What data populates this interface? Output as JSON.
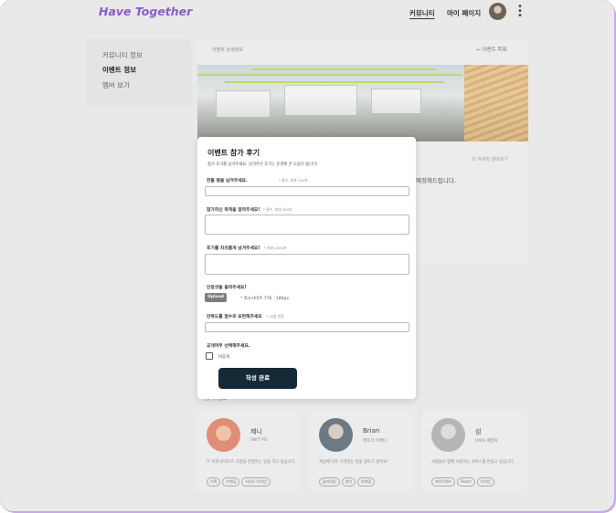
{
  "header": {
    "logo": "Have Together",
    "nav": [
      "커뮤니티",
      "마이 페이지"
    ],
    "menu_icon": "kebab-menu-icon",
    "avatar_icon": "user-avatar"
  },
  "sidebar": {
    "items": [
      {
        "label": "커뮤니티 정보"
      },
      {
        "label": "이벤트 정보"
      },
      {
        "label": "멤버 보기"
      }
    ]
  },
  "main": {
    "breadcrumb": "이벤트 상세정보",
    "back_link": "← 이벤트 목록",
    "more_link": "더 자세히 알아보기",
    "description_tail": "예정해드립니다.",
    "members_title": "멤버 정보"
  },
  "members": [
    {
      "name": "제니",
      "role": "UNIT PO",
      "desc": "IT 커뮤니티와 IT 기업을 연결하는 일을 하고 있습니다.",
      "tags": [
        "기획",
        "브랜딩",
        "서비스 디자인"
      ],
      "photo_color": "#e08e78"
    },
    {
      "name": "Brian",
      "role": "맨토크 이케다",
      "desc": "세상에 더욱 가치있는 일을 찾아고 싶어요!",
      "tags": [
        "플러터팀",
        "영어",
        "마케팅"
      ],
      "photo_color": "#6c7a86"
    },
    {
      "name": "섬",
      "role": "UXIS 개발자",
      "desc": "사람들이 함께 사용하는 서비스를 만들고 있습니다.",
      "tags": [
        "프론트엔드",
        "React",
        "디자인"
      ],
      "photo_color": "#c9c9c9"
    }
  ],
  "modal": {
    "title": "이벤트 참가 후기",
    "subtitle": "참가 후기를 남겨주세요. 남겨주신 후기는 운영에 큰 도움이 됩니다!",
    "fields": [
      {
        "label": "한줄 평을 남겨주세요.",
        "hint": "* 필수, 최대 100자"
      },
      {
        "label": "참가하신 목적을 알려주세요!",
        "hint": "* 필수, 최대 300자"
      },
      {
        "label": "후기를 자유롭게 남겨주세요!",
        "hint": "* 최대 1000자"
      }
    ],
    "photo_label": "인증샷을 올려주세요!",
    "upload_button": "Upload",
    "upload_hint": "* 최소사이즈 776 - 180px",
    "rating_label": "만족도를 점수로 표현해주세요",
    "rating_hint": "* 10점 만점",
    "visibility_label": "공개여부 선택해주세요.",
    "private_label": "비공개",
    "submit_button": "작성 완료"
  },
  "colors": {
    "brand": "#8a5bc7",
    "submit": "#152a36",
    "frame_accent": "#c9a9e6"
  }
}
